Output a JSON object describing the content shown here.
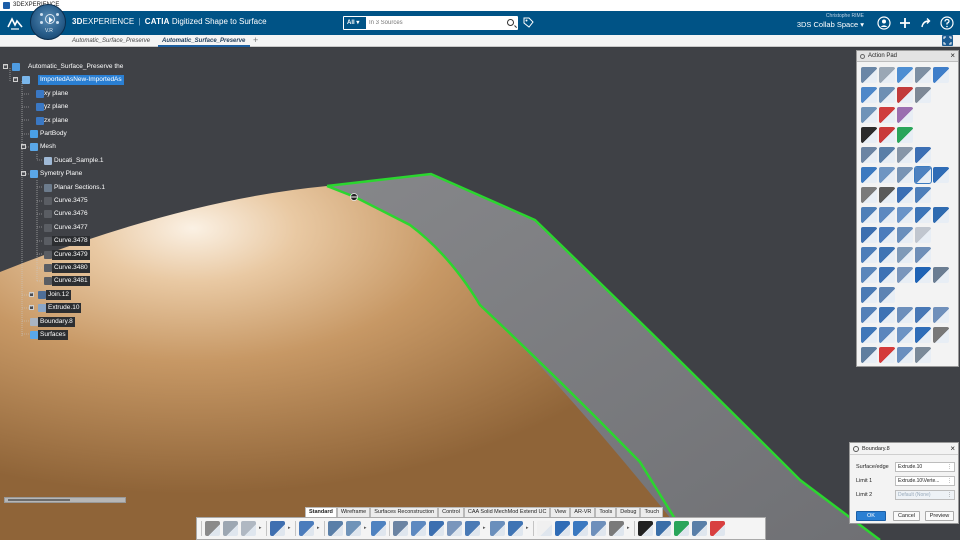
{
  "window": {
    "title": "3DEXPERIENCE"
  },
  "header": {
    "brand_prefix": "3D",
    "brand_main": "EXPERIENCE",
    "brand_sep": "|",
    "app_name": "CATIA",
    "app_detail": "Digitized Shape to Surface",
    "compass_version": "V.R",
    "search": {
      "scope": "All",
      "placeholder": "In 3 Sources"
    },
    "user_name": "Christophe RIME",
    "collab_space": "3DS Collab Space",
    "accent": "#005386"
  },
  "tabs": [
    {
      "label": "Automatic_Surface_Preserve",
      "active": false
    },
    {
      "label": "Automatic_Surface_Preserve",
      "active": true
    }
  ],
  "tree": {
    "nodes": [
      {
        "label": "Automatic_Surface_Preserve the",
        "icon": "product-icon",
        "hl": ""
      },
      {
        "label": "ImportedAsNew-ImportedAs",
        "icon": "part-icon",
        "hl": "hl"
      },
      {
        "label": "xy plane",
        "icon": "plane-icon",
        "hl": ""
      },
      {
        "label": "yz plane",
        "icon": "plane-icon",
        "hl": ""
      },
      {
        "label": "zx plane",
        "icon": "plane-icon",
        "hl": ""
      },
      {
        "label": "PartBody",
        "icon": "body-icon",
        "hl": ""
      },
      {
        "label": "Mesh",
        "icon": "geoset-icon",
        "hl": ""
      },
      {
        "label": "Ducati_Sample.1",
        "icon": "mesh-icon",
        "hl": ""
      },
      {
        "label": "Symetry Plane",
        "icon": "geoset-icon",
        "hl": ""
      },
      {
        "label": "Planar Sections.1",
        "icon": "section-icon",
        "hl": ""
      },
      {
        "label": "Curve.3475",
        "icon": "curve-icon",
        "hl": ""
      },
      {
        "label": "Curve.3476",
        "icon": "curve-icon",
        "hl": ""
      },
      {
        "label": "Curve.3477",
        "icon": "curve-icon",
        "hl": ""
      },
      {
        "label": "Curve.3478",
        "icon": "curve-icon",
        "hl": "dk"
      },
      {
        "label": "Curve.3479",
        "icon": "curve-icon",
        "hl": "dk"
      },
      {
        "label": "Curve.3480",
        "icon": "curve-icon",
        "hl": "dk"
      },
      {
        "label": "Curve.3481",
        "icon": "curve-icon",
        "hl": "dk"
      },
      {
        "label": "Join.12",
        "icon": "join-icon",
        "hl": "dk"
      },
      {
        "label": "Extrude.10",
        "icon": "extrude-icon",
        "hl": "dk"
      },
      {
        "label": "Boundary.8",
        "icon": "boundary-icon",
        "hl": "dk"
      },
      {
        "label": "Surfaces",
        "icon": "geoset-icon",
        "hl": "dk"
      }
    ]
  },
  "action_pad": {
    "title": "Action Pad"
  },
  "boundary_panel": {
    "title": "Boundary.8",
    "fields": [
      {
        "label": "Surface/edge",
        "value": "Extrude.10",
        "disabled": false
      },
      {
        "label": "Limit 1",
        "value": "Extrude.10\\Verte...",
        "disabled": false
      },
      {
        "label": "Limit 2",
        "value": "Default (None)",
        "disabled": true
      }
    ],
    "buttons": {
      "ok": "OK",
      "cancel": "Cancel",
      "preview": "Preview"
    }
  },
  "section_tabs": [
    "Standard",
    "Wireframe",
    "Surfaces Reconstruction",
    "Control",
    "CAA Solid MechMod Extend UC",
    "View",
    "AR-VR",
    "Tools",
    "Debug",
    "Touch"
  ],
  "active_section_tab": "Standard"
}
